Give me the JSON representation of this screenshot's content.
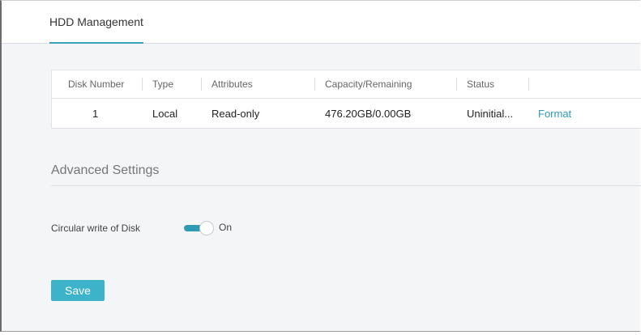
{
  "tabs": [
    {
      "label": "HDD Management",
      "active": true
    }
  ],
  "disk_table": {
    "headers": [
      "Disk Number",
      "Type",
      "Attributes",
      "Capacity/Remaining",
      "Status",
      ""
    ],
    "rows": [
      {
        "disk_number": "1",
        "type": "Local",
        "attributes": "Read-only",
        "capacity": "476.20GB/0.00GB",
        "status": "Uninitial...",
        "action": "Format"
      }
    ]
  },
  "advanced": {
    "title": "Advanced Settings",
    "circular_write_label": "Circular write of Disk",
    "circular_write_state": "On",
    "circular_write_enabled": true
  },
  "buttons": {
    "save": "Save"
  },
  "colors": {
    "accent": "#3aa3b8",
    "button": "#3cb3c8",
    "link": "#2e9bb3"
  }
}
